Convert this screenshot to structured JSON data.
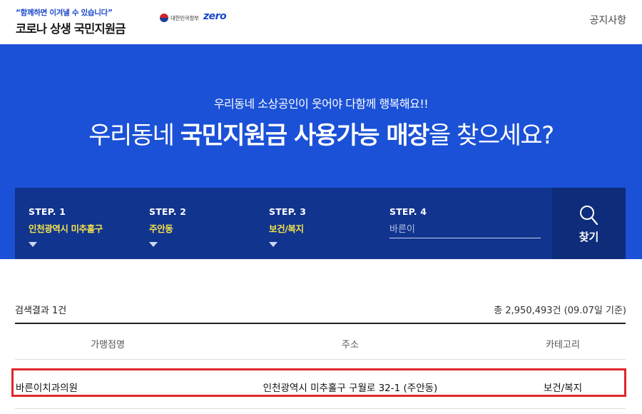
{
  "header": {
    "slogan": "“함께하면 이겨낼 수 있습니다”",
    "title": "코로나 상생 국민지원금",
    "gov_label": "대한민국정부",
    "zero_label": "zero",
    "notice_link": "공지사항"
  },
  "hero": {
    "subtitle": "우리동네 소상공인이 웃어야 다함께 행복해요!!",
    "title_prefix": "우리동네 ",
    "title_bold": "국민지원금 사용가능 매장",
    "title_suffix": "을 찾으세요?"
  },
  "search": {
    "steps": [
      {
        "label": "STEP. 1",
        "value": "인천광역시 미추홀구"
      },
      {
        "label": "STEP. 2",
        "value": "주안동"
      },
      {
        "label": "STEP. 3",
        "value": "보건/복지"
      },
      {
        "label": "STEP. 4",
        "placeholder": "바른이"
      }
    ],
    "button_label": "찾기"
  },
  "results": {
    "count_text": "검색결과 1건",
    "total_text": "총 2,950,493건 (09.07일 기준)",
    "columns": [
      "가맹점명",
      "주소",
      "카테고리"
    ],
    "rows": [
      {
        "name": "바른이치과의원",
        "address": "인천광역시 미추홀구 구월로 32-1 (주안동)",
        "category": "보건/복지"
      }
    ]
  },
  "colors": {
    "hero_bg": "#1b51d6",
    "search_bg": "#11348f",
    "search_btn_bg": "#0e2c7a",
    "step_value": "#f5e34a",
    "highlight": "#e0262c"
  }
}
